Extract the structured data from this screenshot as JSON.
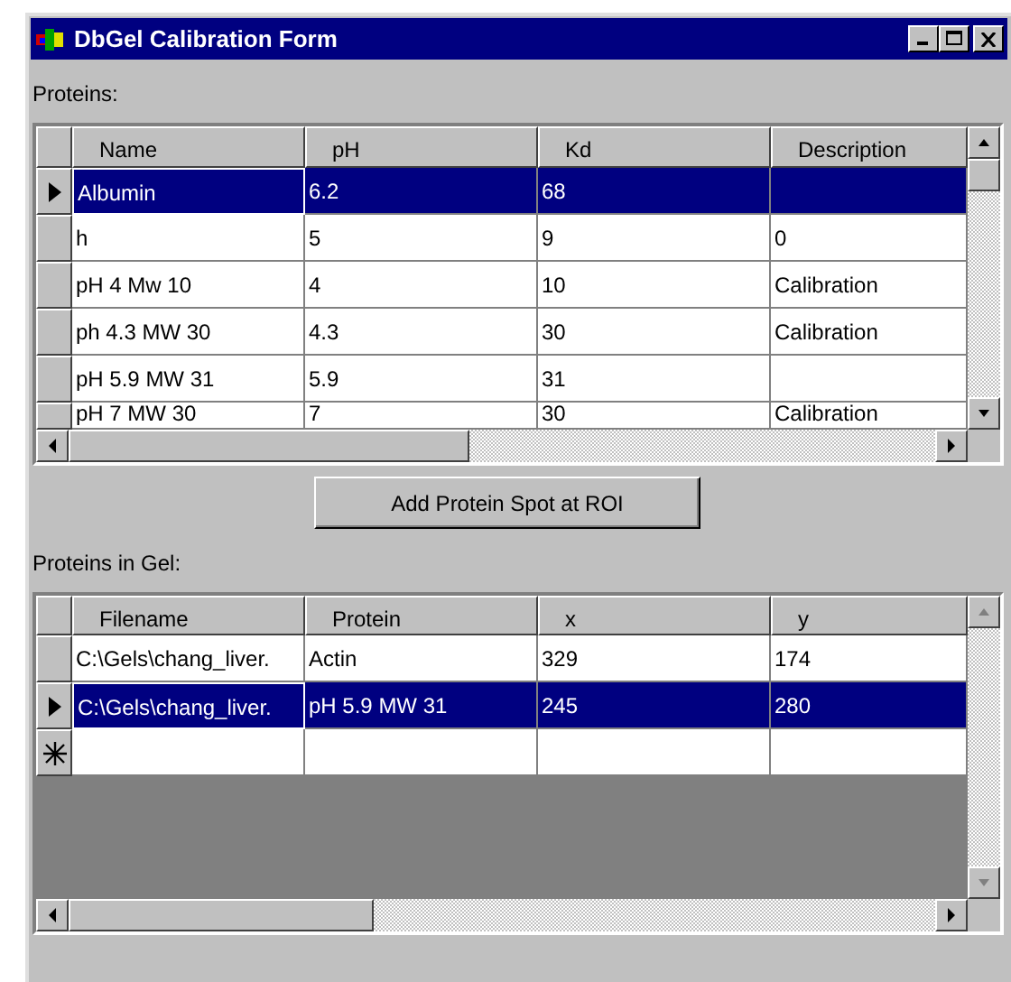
{
  "window": {
    "title": "DbGel Calibration Form"
  },
  "proteins": {
    "label": "Proteins:",
    "columns": [
      "Name",
      "pH",
      "Kd",
      "Description"
    ],
    "rows": [
      {
        "cells": [
          "Albumin",
          "6.2",
          "68",
          ""
        ],
        "selected": true
      },
      {
        "cells": [
          "h",
          "5",
          "9",
          "0"
        ],
        "selected": false
      },
      {
        "cells": [
          "pH 4 Mw 10",
          "4",
          "10",
          "Calibration"
        ],
        "selected": false
      },
      {
        "cells": [
          "ph 4.3 MW 30",
          "4.3",
          "30",
          "Calibration"
        ],
        "selected": false
      },
      {
        "cells": [
          "pH 5.9 MW 31",
          "5.9",
          "31",
          ""
        ],
        "selected": false
      },
      {
        "cells": [
          "pH 7 MW 30",
          "7",
          "30",
          "Calibration"
        ],
        "selected": false
      }
    ]
  },
  "add_button": "Add Protein Spot at ROI",
  "gel": {
    "label": "Proteins in Gel:",
    "columns": [
      "Filename",
      "Protein",
      "x",
      "y"
    ],
    "rows": [
      {
        "cells": [
          "C:\\Gels\\chang_liver.",
          "Actin",
          "329",
          "174"
        ],
        "selected": false
      },
      {
        "cells": [
          "C:\\Gels\\chang_liver.",
          "pH 5.9 MW 31",
          "245",
          "280"
        ],
        "selected": true
      }
    ],
    "new_row": true
  }
}
